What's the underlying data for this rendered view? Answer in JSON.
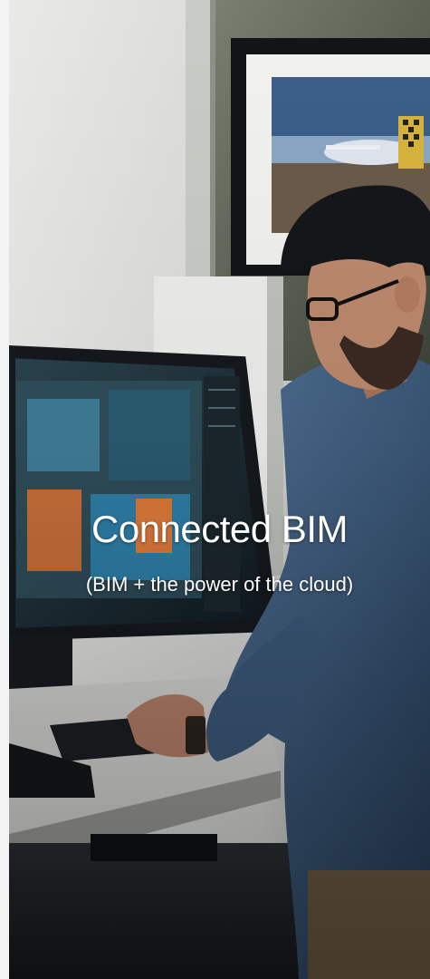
{
  "hero": {
    "title": "Connected BIM",
    "subtitle": "(BIM + the power of the cloud)"
  },
  "colors": {
    "wall": "#e6e6e4",
    "shirt": "#3f5d80",
    "desk": "#d9d9d9",
    "monitor_frame": "#1f2328",
    "hair": "#15161a",
    "skin": "#b98467",
    "title_text": "#ffffff"
  }
}
